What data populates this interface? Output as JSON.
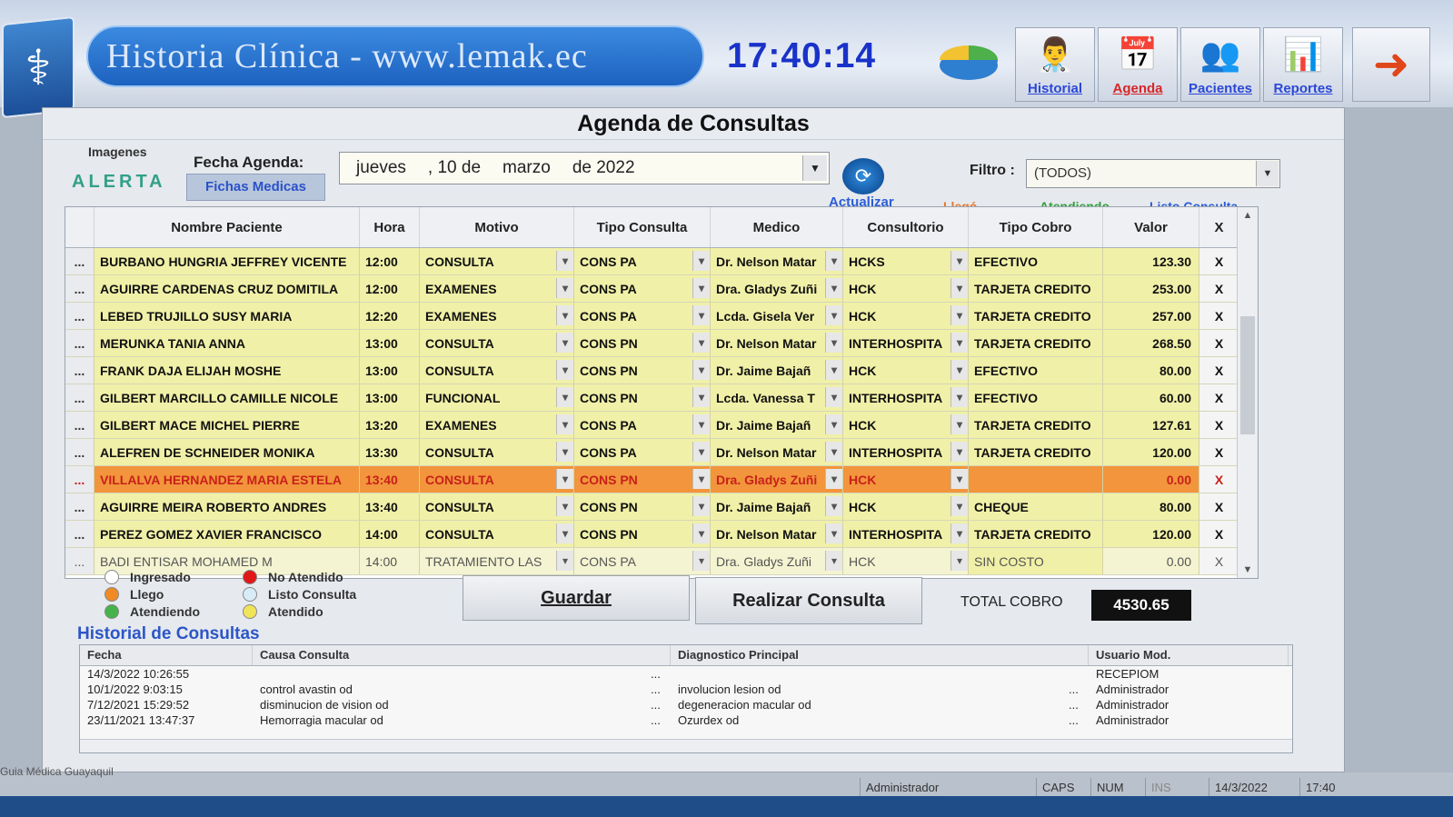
{
  "header": {
    "title": "Historia Clínica - www.lemak.ec",
    "clock": "17:40:14",
    "nav": [
      {
        "label": "Historial",
        "icon": "doctor-icon",
        "color": "#2b48d6"
      },
      {
        "label": "Agenda",
        "icon": "calendar-icon",
        "color": "#d6262a"
      },
      {
        "label": "Pacientes",
        "icon": "patients-icon",
        "color": "#2b48d6"
      },
      {
        "label": "Reportes",
        "icon": "reports-icon",
        "color": "#2b48d6"
      }
    ]
  },
  "panel": {
    "title": "Agenda  de Consultas",
    "imagenes_label": "Imagenes",
    "alerta_label": "ALERTA",
    "fecha_label": "Fecha Agenda:",
    "fichas_button": "Fichas Medicas",
    "date": {
      "weekday": "jueves",
      "day": ", 10 de",
      "month": "marzo",
      "year": "de 2022"
    },
    "actualizar_label": "Actualizar",
    "filtro_label": "Filtro :",
    "filtro_value": "(TODOS)",
    "status_labels": {
      "llego": "Llegó",
      "atendiendo": "Atendiendo",
      "listo": "Listo Consulta"
    }
  },
  "grid": {
    "columns": [
      "Nombre Paciente",
      "Hora",
      "Motivo",
      "Tipo Consulta",
      "Medico",
      "Consultorio",
      "Tipo Cobro",
      "Valor",
      "X"
    ],
    "rows": [
      {
        "rh": "...",
        "nombre": "BURBANO HUNGRIA JEFFREY VICENTE",
        "hora": "12:00",
        "motivo": "CONSULTA",
        "tipo": "CONS PA",
        "medico": "Dr. Nelson Matar",
        "consultorio": "HCKS",
        "cobro": "EFECTIVO",
        "valor": "123.30",
        "x": "X"
      },
      {
        "rh": "...",
        "nombre": "AGUIRRE CARDENAS CRUZ DOMITILA",
        "hora": "12:00",
        "motivo": "EXAMENES",
        "tipo": "CONS PA",
        "medico": "Dra. Gladys Zuñi",
        "consultorio": "HCK",
        "cobro": "TARJETA CREDITO",
        "valor": "253.00",
        "x": "X"
      },
      {
        "rh": "...",
        "nombre": "LEBED TRUJILLO SUSY MARIA",
        "hora": "12:20",
        "motivo": "EXAMENES",
        "tipo": "CONS PA",
        "medico": "Lcda. Gisela Ver",
        "consultorio": "HCK",
        "cobro": "TARJETA CREDITO",
        "valor": "257.00",
        "x": "X"
      },
      {
        "rh": "...",
        "nombre": "MERUNKA TANIA ANNA",
        "hora": "13:00",
        "motivo": "CONSULTA",
        "tipo": "CONS PN",
        "medico": "Dr. Nelson Matar",
        "consultorio": "INTERHOSPITA",
        "cobro": "TARJETA CREDITO",
        "valor": "268.50",
        "x": "X"
      },
      {
        "rh": "...",
        "nombre": "FRANK DAJA ELIJAH MOSHE",
        "hora": "13:00",
        "motivo": "CONSULTA",
        "tipo": "CONS PN",
        "medico": "Dr. Jaime Bajañ",
        "consultorio": "HCK",
        "cobro": "EFECTIVO",
        "valor": "80.00",
        "x": "X"
      },
      {
        "rh": "...",
        "nombre": "GILBERT MARCILLO CAMILLE NICOLE",
        "hora": "13:00",
        "motivo": "FUNCIONAL",
        "tipo": "CONS PN",
        "medico": "Lcda. Vanessa T",
        "consultorio": "INTERHOSPITA",
        "cobro": "EFECTIVO",
        "valor": "60.00",
        "x": "X"
      },
      {
        "rh": "...",
        "nombre": "GILBERT MACE MICHEL PIERRE",
        "hora": "13:20",
        "motivo": "EXAMENES",
        "tipo": "CONS PA",
        "medico": "Dr. Jaime Bajañ",
        "consultorio": "HCK",
        "cobro": "TARJETA CREDITO",
        "valor": "127.61",
        "x": "X"
      },
      {
        "rh": "...",
        "nombre": "ALEFREN DE SCHNEIDER MONIKA",
        "hora": "13:30",
        "motivo": "CONSULTA",
        "tipo": "CONS PA",
        "medico": "Dr. Nelson Matar",
        "consultorio": "INTERHOSPITA",
        "cobro": "TARJETA CREDITO",
        "valor": "120.00",
        "x": "X"
      },
      {
        "rh": "...",
        "nombre": "VILLALVA HERNANDEZ MARIA ESTELA",
        "hora": "13:40",
        "motivo": "CONSULTA",
        "tipo": "CONS PN",
        "medico": "Dra. Gladys Zuñi",
        "consultorio": "HCK",
        "cobro": "",
        "valor": "0.00",
        "x": "X"
      },
      {
        "rh": "...",
        "nombre": "AGUIRRE MEIRA ROBERTO ANDRES",
        "hora": "13:40",
        "motivo": "CONSULTA",
        "tipo": "CONS PN",
        "medico": "Dr. Jaime Bajañ",
        "consultorio": "HCK",
        "cobro": "CHEQUE",
        "valor": "80.00",
        "x": "X"
      },
      {
        "rh": "...",
        "nombre": "PEREZ GOMEZ XAVIER FRANCISCO",
        "hora": "14:00",
        "motivo": "CONSULTA",
        "tipo": "CONS PN",
        "medico": "Dr. Nelson Matar",
        "consultorio": "INTERHOSPITA",
        "cobro": "TARJETA CREDITO",
        "valor": "120.00",
        "x": "X"
      },
      {
        "rh": "...",
        "nombre": "BADI ENTISAR MOHAMED M",
        "hora": "14:00",
        "motivo": "TRATAMIENTO LAS",
        "tipo": "CONS PA",
        "medico": "Dra. Gladys Zuñi",
        "consultorio": "HCK",
        "cobro": "SIN COSTO",
        "valor": "0.00",
        "x": "X"
      }
    ]
  },
  "legend": [
    {
      "label": "Ingresado",
      "color": "#ffffff"
    },
    {
      "label": "Llego",
      "color": "#f08a24"
    },
    {
      "label": "Atendiendo",
      "color": "#45b34a"
    },
    {
      "label": "No Atendido",
      "color": "#e01818"
    },
    {
      "label": "Listo Consulta",
      "color": "#d8ecf7"
    },
    {
      "label": "Atendido",
      "color": "#f0e45a"
    }
  ],
  "actions": {
    "guardar": "Guardar",
    "realizar": "Realizar Consulta",
    "total_label": "TOTAL COBRO",
    "total_value": "4530.65"
  },
  "historial": {
    "title": "Historial de Consultas",
    "columns": [
      "Fecha",
      "Causa Consulta",
      "Diagnostico Principal",
      "Usuario Mod."
    ],
    "rows": [
      {
        "fecha": "14/3/2022 10:26:55",
        "causa": "",
        "d1": "...",
        "diag": "",
        "d2": "",
        "usuario": "RECEPIOM"
      },
      {
        "fecha": "10/1/2022 9:03:15",
        "causa": "control avastin od",
        "d1": "...",
        "diag": "involucion lesion od",
        "d2": "...",
        "usuario": "Administrador"
      },
      {
        "fecha": "7/12/2021 15:29:52",
        "causa": "disminucion de vision od",
        "d1": "...",
        "diag": "degeneracion macular od",
        "d2": "...",
        "usuario": "Administrador"
      },
      {
        "fecha": "23/11/2021 13:47:37",
        "causa": "Hemorragia macular od",
        "d1": "...",
        "diag": "Ozurdex od",
        "d2": "...",
        "usuario": "Administrador"
      }
    ]
  },
  "statusbar": {
    "guia": "Guia Médica Guayaquil",
    "user": "Administrador",
    "caps": "CAPS",
    "num": "NUM",
    "ins": "INS",
    "date": "14/3/2022",
    "time": "17:40"
  }
}
